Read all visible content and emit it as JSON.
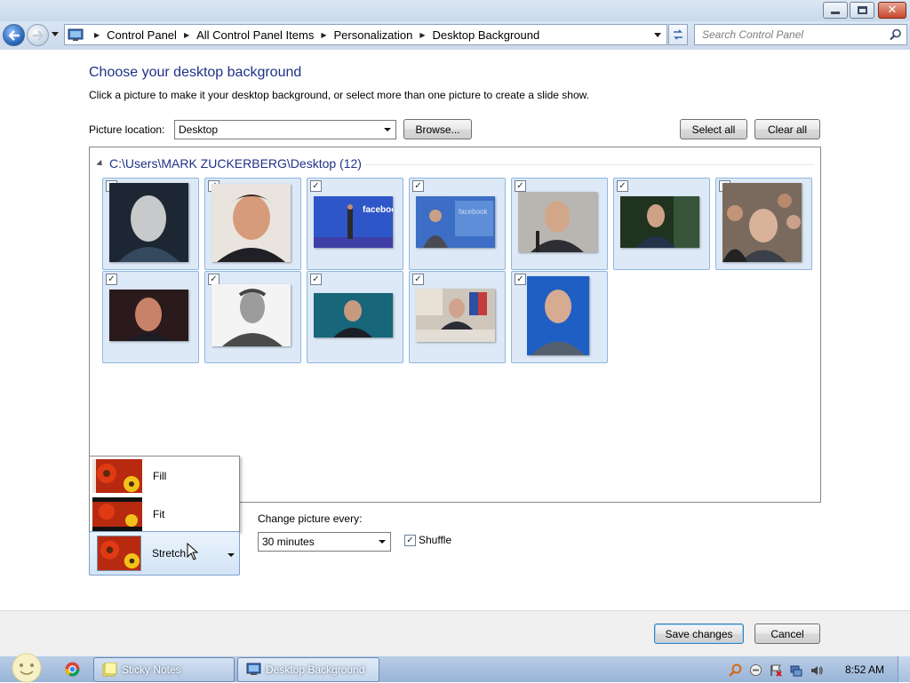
{
  "window": {
    "minimize_icon": "minimize-icon",
    "maximize_icon": "restore-icon",
    "close_icon": "close-icon"
  },
  "address_bar": {
    "breadcrumb": [
      "Control Panel",
      "All Control Panel Items",
      "Personalization",
      "Desktop Background"
    ],
    "search_placeholder": "Search Control Panel"
  },
  "page": {
    "title": "Choose your desktop background",
    "description": "Click a picture to make it your desktop background, or select more than one picture to create a slide show.",
    "picture_location_label": "Picture location:",
    "picture_location_value": "Desktop",
    "browse_label": "Browse...",
    "select_all_label": "Select all",
    "clear_all_label": "Clear all"
  },
  "gallery": {
    "group_header": "C:\\Users\\MARK ZUCKERBERG\\Desktop (12)",
    "items": [
      {
        "checked": true,
        "icon": "portrait-photo"
      },
      {
        "checked": true,
        "icon": "portrait-photo"
      },
      {
        "checked": true,
        "icon": "stage-photo"
      },
      {
        "checked": true,
        "icon": "stage-photo"
      },
      {
        "checked": true,
        "icon": "portrait-photo"
      },
      {
        "checked": true,
        "icon": "portrait-photo"
      },
      {
        "checked": true,
        "icon": "group-photo"
      },
      {
        "checked": true,
        "icon": "portrait-photo"
      },
      {
        "checked": true,
        "icon": "portrait-photo"
      },
      {
        "checked": true,
        "icon": "portrait-photo"
      },
      {
        "checked": true,
        "icon": "desk-photo"
      },
      {
        "checked": true,
        "icon": "portrait-photo"
      }
    ]
  },
  "picture_position": {
    "menu_options": [
      "Fill",
      "Fit"
    ],
    "selected": "Stretch"
  },
  "slideshow": {
    "change_label": "Change picture every:",
    "interval_value": "30 minutes",
    "shuffle_label": "Shuffle",
    "shuffle_checked": true
  },
  "footer": {
    "save_label": "Save changes",
    "cancel_label": "Cancel"
  },
  "taskbar": {
    "tasks": [
      "Sticky Notes",
      "Desktop Background"
    ],
    "clock": "8:52 AM"
  },
  "colors": {
    "title_blue": "#1e3287",
    "tile_bg": "#dde9f7",
    "tile_border": "#8fb6e2"
  }
}
